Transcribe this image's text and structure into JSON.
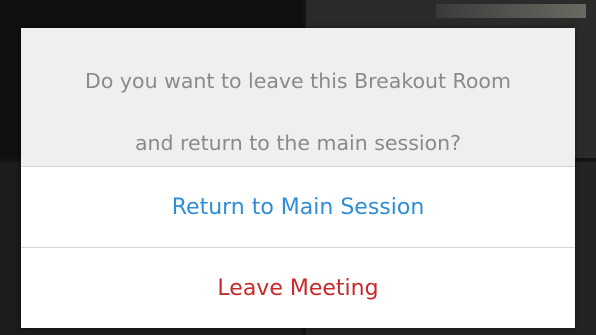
{
  "dialog": {
    "message_line1": "Do you want to leave this Breakout Room",
    "message_line2": "and return to the main session?",
    "actions": [
      {
        "label": "Return to Main Session",
        "color": "#2d8ed6"
      },
      {
        "label": "Leave Meeting",
        "color": "#c8292b"
      }
    ]
  }
}
